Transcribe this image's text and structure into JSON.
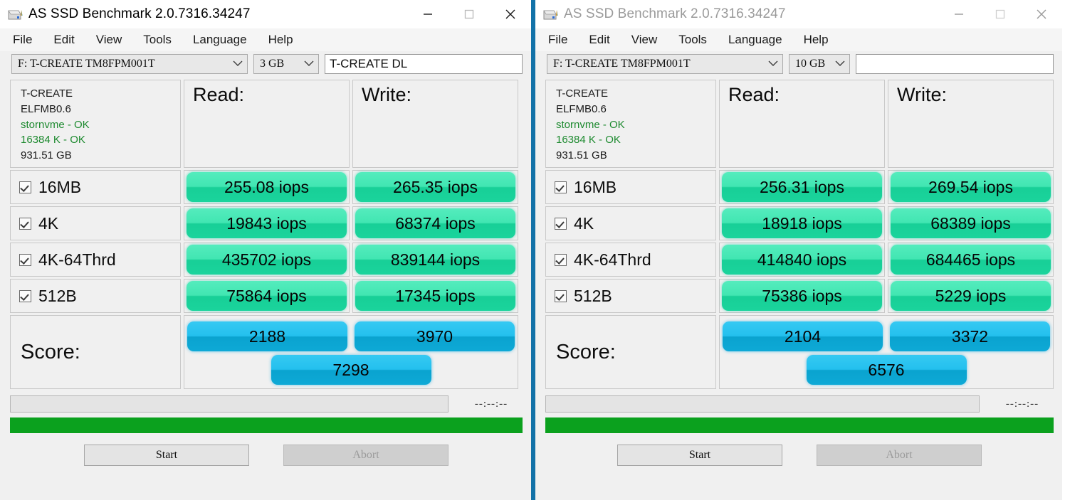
{
  "windows": [
    {
      "id": "left",
      "state": "active",
      "titlebar": {
        "icon": "hard-drive-icon",
        "title": "AS SSD Benchmark 2.0.7316.34247",
        "minimize": "—",
        "maximize": "□",
        "close": "✕"
      },
      "menu": [
        "File",
        "Edit",
        "View",
        "Tools",
        "Language",
        "Help"
      ],
      "toolbar": {
        "drive": "F: T-CREATE TM8FPM001T",
        "size": "3 GB",
        "name_value": "T-CREATE DL",
        "name_placeholder": ""
      },
      "drive_info": {
        "model": "T-CREATE",
        "firmware": "ELFMB0.6",
        "driver": "stornvme - OK",
        "alignment": "16384 K - OK",
        "capacity": "931.51 GB"
      },
      "headers": {
        "read": "Read:",
        "write": "Write:"
      },
      "tests": [
        {
          "label": "16MB",
          "checked": true,
          "read": "255.08 iops",
          "write": "265.35 iops"
        },
        {
          "label": "4K",
          "checked": true,
          "read": "19843 iops",
          "write": "68374 iops"
        },
        {
          "label": "4K-64Thrd",
          "checked": true,
          "read": "435702 iops",
          "write": "839144 iops"
        },
        {
          "label": "512B",
          "checked": true,
          "read": "75864 iops",
          "write": "17345 iops"
        }
      ],
      "score": {
        "label": "Score:",
        "read": "2188",
        "write": "3970",
        "total": "7298"
      },
      "status": {
        "message": "",
        "timer": "--:--:--",
        "progress_percent": 100
      },
      "buttons": {
        "start": "Start",
        "abort": "Abort"
      }
    },
    {
      "id": "right",
      "state": "inactive",
      "titlebar": {
        "icon": "hard-drive-icon",
        "title": "AS SSD Benchmark 2.0.7316.34247",
        "minimize": "—",
        "maximize": "□",
        "close": "✕"
      },
      "menu": [
        "File",
        "Edit",
        "View",
        "Tools",
        "Language",
        "Help"
      ],
      "toolbar": {
        "drive": "F: T-CREATE TM8FPM001T",
        "size": "10 GB",
        "name_value": "",
        "name_placeholder": ""
      },
      "drive_info": {
        "model": "T-CREATE",
        "firmware": "ELFMB0.6",
        "driver": "stornvme - OK",
        "alignment": "16384 K - OK",
        "capacity": "931.51 GB"
      },
      "headers": {
        "read": "Read:",
        "write": "Write:"
      },
      "tests": [
        {
          "label": "16MB",
          "checked": true,
          "read": "256.31 iops",
          "write": "269.54 iops"
        },
        {
          "label": "4K",
          "checked": true,
          "read": "18918 iops",
          "write": "68389 iops"
        },
        {
          "label": "4K-64Thrd",
          "checked": true,
          "read": "414840 iops",
          "write": "684465 iops"
        },
        {
          "label": "512B",
          "checked": true,
          "read": "75386 iops",
          "write": "5229 iops"
        }
      ],
      "score": {
        "label": "Score:",
        "read": "2104",
        "write": "3372",
        "total": "6576"
      },
      "status": {
        "message": "",
        "timer": "--:--:--",
        "progress_percent": 100
      },
      "buttons": {
        "start": "Start",
        "abort": "Abort"
      }
    }
  ],
  "colors": {
    "result_green_light": "#55ecbd",
    "result_green_dark": "#18cf97",
    "score_blue_light": "#35c9f2",
    "score_blue_dark": "#0aa3cf",
    "progress_green": "#0ba11e",
    "window_divider_blue": "#1272a8",
    "ok_text_green": "#1d8a2f"
  }
}
